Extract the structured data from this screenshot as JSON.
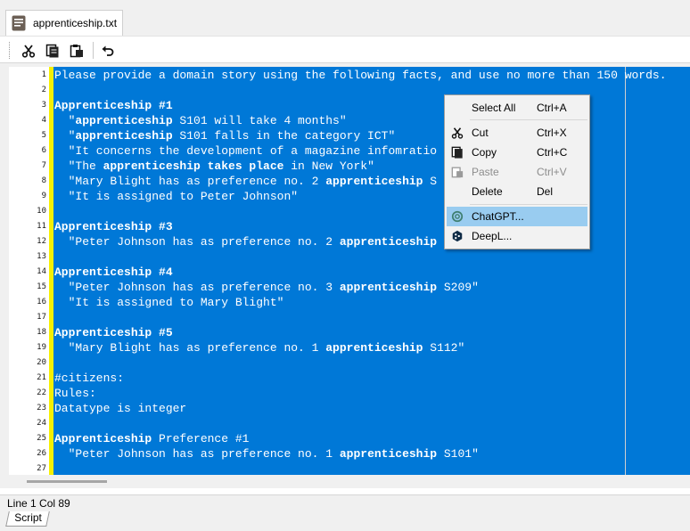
{
  "tab": {
    "label": "apprenticeship.txt"
  },
  "editor_lines": [
    {
      "n": "1",
      "segs": [
        {
          "t": "Please provide a domain story using the following facts, and use no more than 150 words.",
          "b": false
        }
      ]
    },
    {
      "n": "2",
      "segs": [
        {
          "t": "",
          "b": false
        }
      ]
    },
    {
      "n": "3",
      "segs": [
        {
          "t": "Apprenticeship #1",
          "b": true
        }
      ]
    },
    {
      "n": "4",
      "segs": [
        {
          "t": "  \"",
          "b": false
        },
        {
          "t": "apprenticeship",
          "b": true
        },
        {
          "t": " S101 will take 4 months\"",
          "b": false
        }
      ]
    },
    {
      "n": "5",
      "segs": [
        {
          "t": "  \"",
          "b": false
        },
        {
          "t": "apprenticeship",
          "b": true
        },
        {
          "t": " S101 falls in the category ICT\"",
          "b": false
        }
      ]
    },
    {
      "n": "6",
      "segs": [
        {
          "t": "  \"It concerns the development of a magazine infomratio",
          "b": false
        }
      ]
    },
    {
      "n": "7",
      "segs": [
        {
          "t": "  \"The ",
          "b": false
        },
        {
          "t": "apprenticeship takes place",
          "b": true
        },
        {
          "t": " in New York\"",
          "b": false
        }
      ]
    },
    {
      "n": "8",
      "segs": [
        {
          "t": "  \"Mary Blight has as preference no. 2 ",
          "b": false
        },
        {
          "t": "apprenticeship",
          "b": true
        },
        {
          "t": " S",
          "b": false
        }
      ]
    },
    {
      "n": "9",
      "segs": [
        {
          "t": "  \"It is assigned to Peter Johnson\"",
          "b": false
        }
      ]
    },
    {
      "n": "10",
      "segs": [
        {
          "t": "",
          "b": false
        }
      ]
    },
    {
      "n": "11",
      "segs": [
        {
          "t": "Apprenticeship #3",
          "b": true
        }
      ]
    },
    {
      "n": "12",
      "segs": [
        {
          "t": "  \"Peter Johnson has as preference no. 2 ",
          "b": false
        },
        {
          "t": "apprenticeship",
          "b": true
        }
      ]
    },
    {
      "n": "13",
      "segs": [
        {
          "t": "",
          "b": false
        }
      ]
    },
    {
      "n": "14",
      "segs": [
        {
          "t": "Apprenticeship #4",
          "b": true
        }
      ]
    },
    {
      "n": "15",
      "segs": [
        {
          "t": "  \"Peter Johnson has as preference no. 3 ",
          "b": false
        },
        {
          "t": "apprenticeship",
          "b": true
        },
        {
          "t": " S209\"",
          "b": false
        }
      ]
    },
    {
      "n": "16",
      "segs": [
        {
          "t": "  \"It is assigned to Mary Blight\"",
          "b": false
        }
      ]
    },
    {
      "n": "17",
      "segs": [
        {
          "t": "",
          "b": false
        }
      ]
    },
    {
      "n": "18",
      "segs": [
        {
          "t": "Apprenticeship #5",
          "b": true
        }
      ]
    },
    {
      "n": "19",
      "segs": [
        {
          "t": "  \"Mary Blight has as preference no. 1 ",
          "b": false
        },
        {
          "t": "apprenticeship",
          "b": true
        },
        {
          "t": " S112\"",
          "b": false
        }
      ]
    },
    {
      "n": "20",
      "segs": [
        {
          "t": "",
          "b": false
        }
      ]
    },
    {
      "n": "21",
      "segs": [
        {
          "t": "#citizens:",
          "b": false
        }
      ]
    },
    {
      "n": "22",
      "segs": [
        {
          "t": "Rules:",
          "b": false
        }
      ]
    },
    {
      "n": "23",
      "segs": [
        {
          "t": "Datatype is integer",
          "b": false
        }
      ]
    },
    {
      "n": "24",
      "segs": [
        {
          "t": "",
          "b": false
        }
      ]
    },
    {
      "n": "25",
      "segs": [
        {
          "t": "Apprenticeship",
          "b": true
        },
        {
          "t": " Preference #1",
          "b": false
        }
      ]
    },
    {
      "n": "26",
      "segs": [
        {
          "t": "  \"Peter Johnson has as preference no. 1 ",
          "b": false
        },
        {
          "t": "apprenticeship",
          "b": true
        },
        {
          "t": " S101\"",
          "b": false
        }
      ]
    },
    {
      "n": "27",
      "segs": [
        {
          "t": "",
          "b": false
        }
      ]
    }
  ],
  "context_menu": {
    "select_all": {
      "label": "Select All",
      "shortcut": "Ctrl+A"
    },
    "cut": {
      "label": "Cut",
      "shortcut": "Ctrl+X"
    },
    "copy": {
      "label": "Copy",
      "shortcut": "Ctrl+C"
    },
    "paste": {
      "label": "Paste",
      "shortcut": "Ctrl+V"
    },
    "delete": {
      "label": "Delete",
      "shortcut": "Del"
    },
    "chatgpt": {
      "label": "ChatGPT..."
    },
    "deepl": {
      "label": "DeepL..."
    }
  },
  "status": {
    "position": "Line 1 Col 89"
  },
  "bottom_tab": {
    "label": "Script"
  },
  "colors": {
    "selection": "#0078d7",
    "marker": "#f6f001",
    "menu_highlight": "#99ccf0"
  }
}
